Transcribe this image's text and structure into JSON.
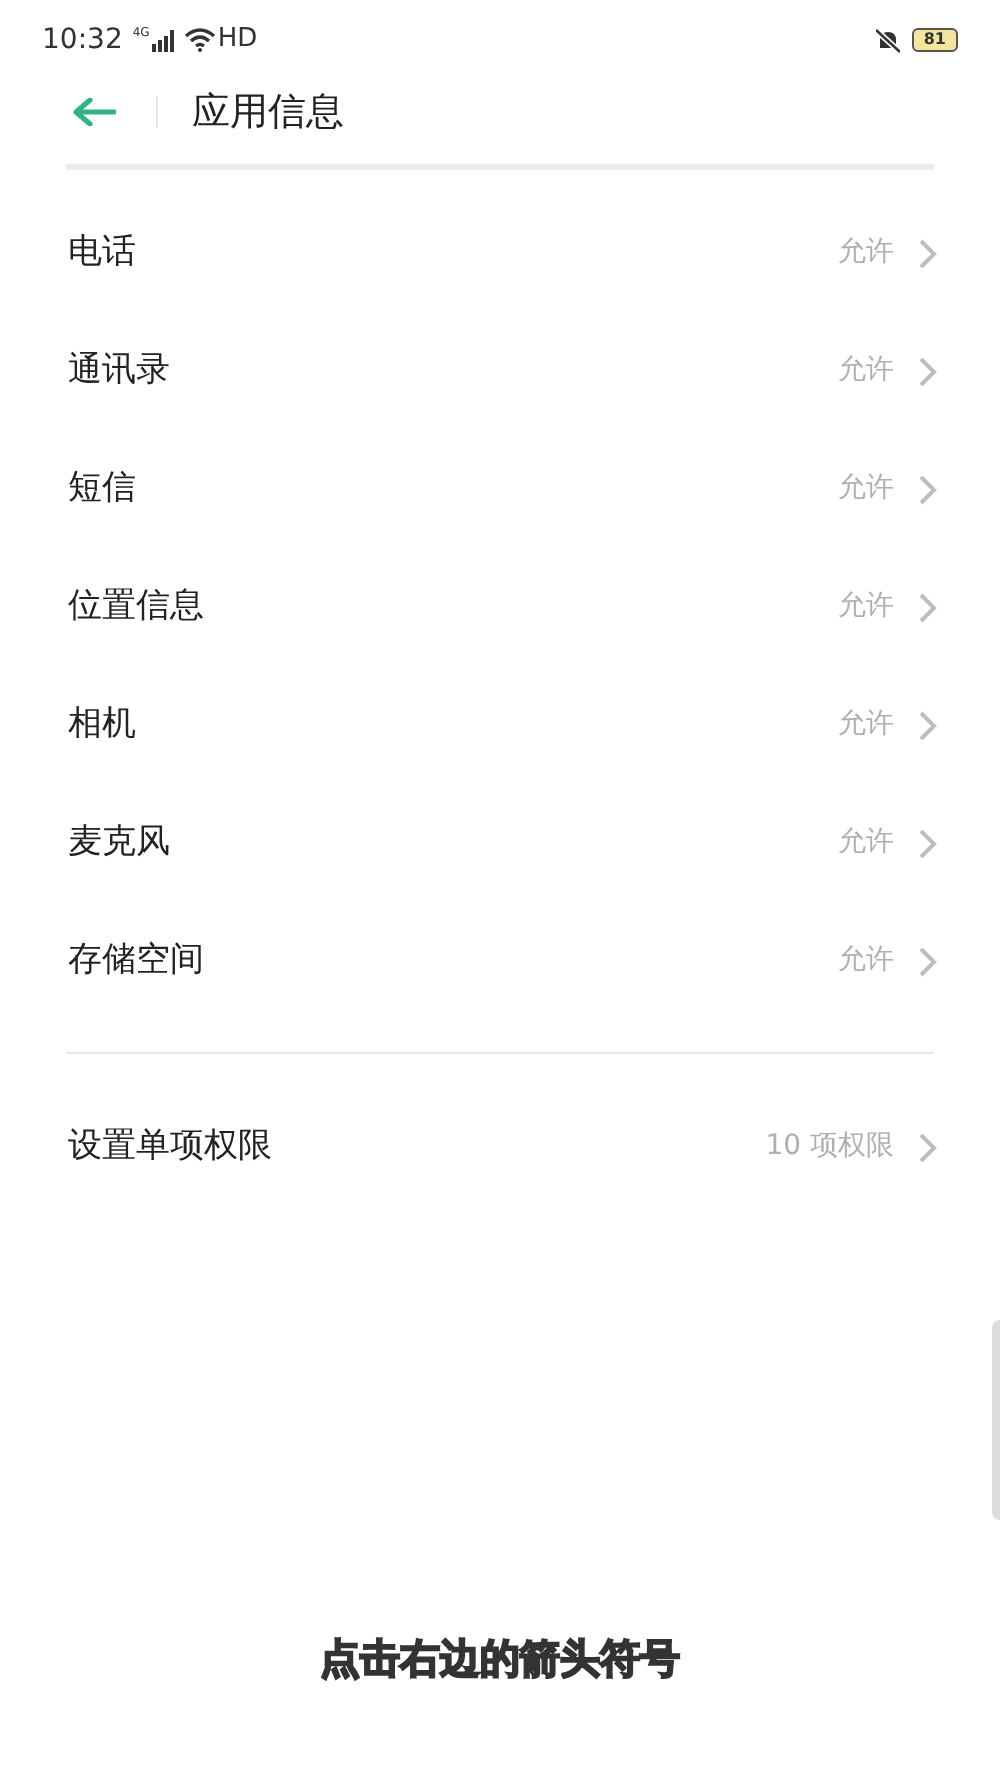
{
  "status_bar": {
    "time": "10:32",
    "network": "4G",
    "wifi_label": "HD",
    "battery": "81"
  },
  "header": {
    "title": "应用信息"
  },
  "permissions": [
    {
      "label": "电话",
      "value": "允许"
    },
    {
      "label": "通讯录",
      "value": "允许"
    },
    {
      "label": "短信",
      "value": "允许"
    },
    {
      "label": "位置信息",
      "value": "允许"
    },
    {
      "label": "相机",
      "value": "允许"
    },
    {
      "label": "麦克风",
      "value": "允许"
    },
    {
      "label": "存储空间",
      "value": "允许"
    }
  ],
  "single_permissions": {
    "label": "设置单项权限",
    "value": "10 项权限"
  },
  "caption": "点击右边的箭头符号"
}
